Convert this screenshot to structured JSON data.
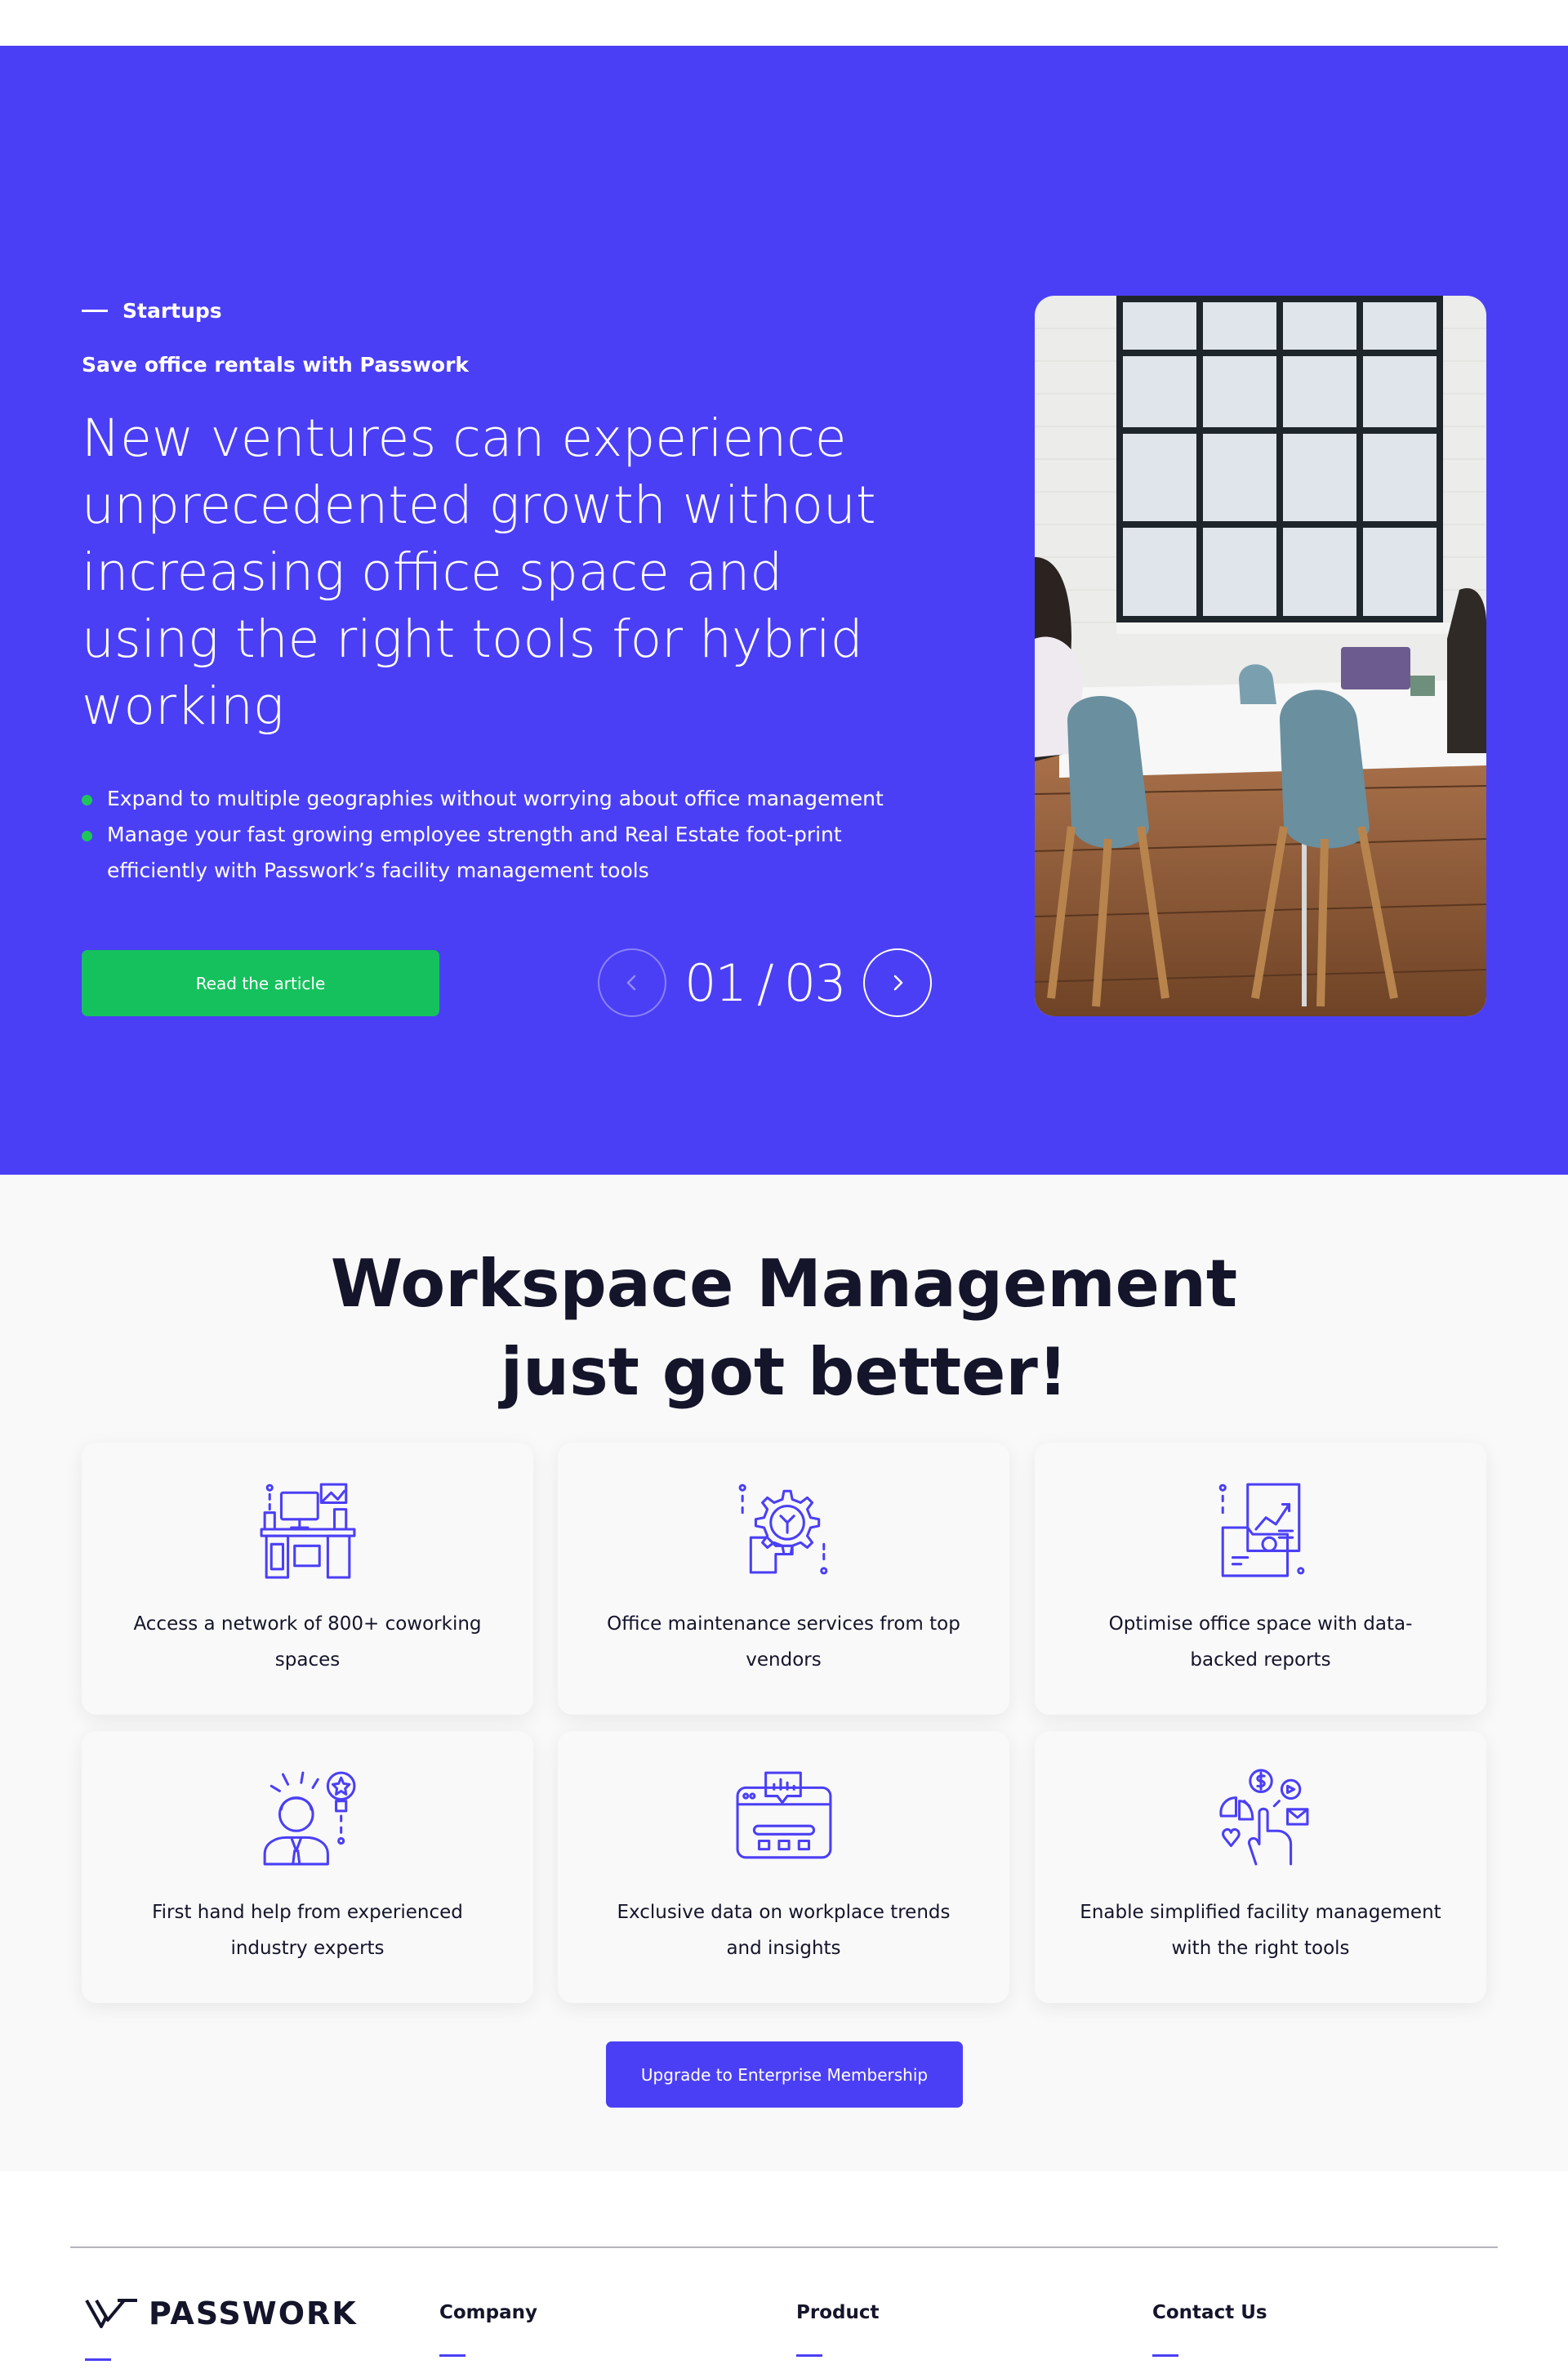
{
  "hero": {
    "tag": "Startups",
    "subtitle": "Save office rentals with Passwork",
    "headline": "New ventures can experience unprecedented growth without increasing office space and using the right tools for hybrid working",
    "bullets": [
      "Expand to multiple geographies without worrying about office management",
      "Manage your fast growing employee strength and Real Estate foot-print efficiently with Passwork’s facility management tools"
    ],
    "cta_label": "Read the article",
    "slide_current": "01",
    "slide_separator": "/",
    "slide_total": "03",
    "colors": {
      "background": "#4b3ff5",
      "cta": "#15c15d",
      "bullet": "#1fc55a"
    }
  },
  "features": {
    "title_line1": "Workspace Management",
    "title_line2": "just got better!",
    "cards": [
      {
        "icon": "workstation-desk-icon",
        "text": "Access a network of 800+ coworking spaces"
      },
      {
        "icon": "maintenance-gear-icon",
        "text": "Office maintenance services from top vendors"
      },
      {
        "icon": "report-folder-chart-icon",
        "text": "Optimise office space with data-backed reports"
      },
      {
        "icon": "expert-lightbulb-icon",
        "text": "First hand help from experienced industry experts"
      },
      {
        "icon": "dashboard-insights-icon",
        "text": "Exclusive data on workplace trends and insights"
      },
      {
        "icon": "facility-tools-icon",
        "text": "Enable simplified facility management with the right tools"
      }
    ],
    "cta_label": "Upgrade to Enterprise Membership",
    "colors": {
      "accent": "#4b3ff5",
      "background": "#f9f9f9"
    }
  },
  "footer": {
    "brand": "PASSWORK",
    "columns": [
      "Company",
      "Product",
      "Contact Us"
    ]
  }
}
